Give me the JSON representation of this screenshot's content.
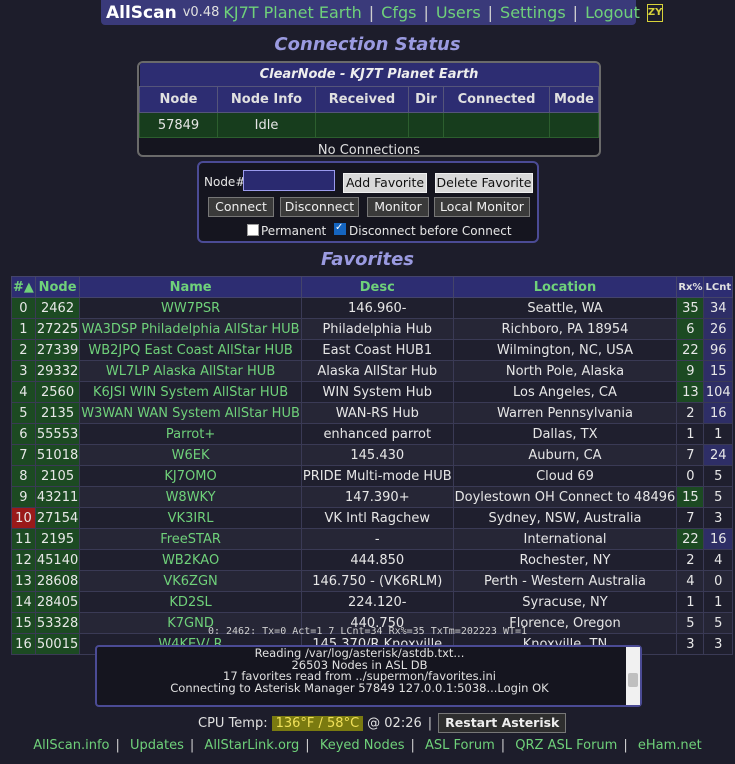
{
  "nav": {
    "brand": "AllScan",
    "version": "v0.48",
    "node_title": "KJ7T Planet Earth",
    "links": [
      "Cfgs",
      "Users",
      "Settings",
      "Logout"
    ],
    "icon": "ZY"
  },
  "connection": {
    "heading": "Connection Status",
    "caption": "ClearNode - KJ7T Planet Earth",
    "columns": [
      "Node",
      "Node Info",
      "Received",
      "Dir",
      "Connected",
      "Mode"
    ],
    "row": {
      "node": "57849",
      "info": "Idle"
    },
    "no_connections": "No Connections"
  },
  "controls": {
    "node_label": "Node#",
    "add_favorite": "Add Favorite",
    "delete_favorite": "Delete Favorite",
    "connect": "Connect",
    "disconnect": "Disconnect",
    "monitor": "Monitor",
    "local_monitor": "Local Monitor",
    "permanent": "Permanent",
    "disconnect_before": "Disconnect before Connect"
  },
  "favorites": {
    "heading": "Favorites",
    "columns": [
      "#▲",
      "Node",
      "Name",
      "Desc",
      "Location",
      "Rx%",
      "LCnt"
    ],
    "rows": [
      {
        "i": "0",
        "node": "2462",
        "name": "WW7PSR",
        "desc": "146.960-",
        "loc": "Seattle, WA",
        "rx": "35",
        "lc": "34"
      },
      {
        "i": "1",
        "node": "27225",
        "name": "WA3DSP Philadelphia AllStar HUB",
        "desc": "Philadelphia Hub",
        "loc": "Richboro, PA 18954",
        "rx": "6",
        "lc": "26"
      },
      {
        "i": "2",
        "node": "27339",
        "name": "WB2JPQ East Coast AllStar HUB",
        "desc": "East Coast HUB1",
        "loc": "Wilmington, NC, USA",
        "rx": "22",
        "lc": "96"
      },
      {
        "i": "3",
        "node": "29332",
        "name": "WL7LP Alaska AllStar HUB",
        "desc": "Alaska AllStar Hub",
        "loc": "North Pole, Alaska",
        "rx": "9",
        "lc": "15"
      },
      {
        "i": "4",
        "node": "2560",
        "name": "K6JSI WIN System AllStar HUB",
        "desc": "WIN System Hub",
        "loc": "Los Angeles, CA",
        "rx": "13",
        "lc": "104"
      },
      {
        "i": "5",
        "node": "2135",
        "name": "W3WAN WAN System AllStar HUB",
        "desc": "WAN-RS Hub",
        "loc": "Warren Pennsylvania",
        "rx": "2",
        "lc": "16"
      },
      {
        "i": "6",
        "node": "55553",
        "name": "Parrot+",
        "desc": "enhanced parrot",
        "loc": "Dallas, TX",
        "rx": "1",
        "lc": "1"
      },
      {
        "i": "7",
        "node": "51018",
        "name": "W6EK",
        "desc": "145.430",
        "loc": "Auburn, CA",
        "rx": "7",
        "lc": "24"
      },
      {
        "i": "8",
        "node": "2105",
        "name": "KJ7OMO",
        "desc": "PRIDE Multi-mode HUB",
        "loc": "Cloud 69",
        "rx": "0",
        "lc": "5"
      },
      {
        "i": "9",
        "node": "43211",
        "name": "W8WKY",
        "desc": "147.390+",
        "loc": "Doylestown OH Connect to 48496",
        "rx": "15",
        "lc": "5"
      },
      {
        "i": "10",
        "node": "27154",
        "name": "VK3IRL",
        "desc": "VK Intl Ragchew",
        "loc": "Sydney, NSW, Australia",
        "rx": "7",
        "lc": "3"
      },
      {
        "i": "11",
        "node": "2195",
        "name": "FreeSTAR",
        "desc": "-",
        "loc": "International",
        "rx": "22",
        "lc": "16"
      },
      {
        "i": "12",
        "node": "45140",
        "name": "WB2KAO",
        "desc": "444.850",
        "loc": "Rochester, NY",
        "rx": "2",
        "lc": "4"
      },
      {
        "i": "13",
        "node": "28608",
        "name": "VK6ZGN",
        "desc": "146.750 - (VK6RLM)",
        "loc": "Perth - Western Australia",
        "rx": "4",
        "lc": "0"
      },
      {
        "i": "14",
        "node": "28405",
        "name": "KD2SL",
        "desc": "224.120-",
        "loc": "Syracuse, NY",
        "rx": "1",
        "lc": "1"
      },
      {
        "i": "15",
        "node": "53328",
        "name": "K7GND",
        "desc": "440.750",
        "loc": "Florence, Oregon",
        "rx": "5",
        "lc": "5"
      },
      {
        "i": "16",
        "node": "50015",
        "name": "W4KEV/ R",
        "desc": "145.370/R Knoxville",
        "loc": "Knoxville, TN",
        "rx": "3",
        "lc": "3"
      }
    ]
  },
  "status_line": "0: 2462: Tx=0 Act=1 7 LCnt=34 Rx%=35 TxTm=202223 WT=1",
  "log_lines": [
    "Reading /var/log/asterisk/astdb.txt...",
    "26503 Nodes in ASL DB",
    "17 favorites read from ../supermon/favorites.ini",
    "Connecting to Asterisk Manager 57849 127.0.0.1:5038...Login OK"
  ],
  "cpu": {
    "label": "CPU Temp:",
    "temp": "136°F / 58°C",
    "time": "@ 02:26",
    "restart": "Restart Asterisk"
  },
  "footer": [
    "AllScan.info",
    "Updates",
    "AllStarLink.org",
    "Keyed Nodes",
    "ASL Forum",
    "QRZ ASL Forum",
    "eHam.net"
  ]
}
